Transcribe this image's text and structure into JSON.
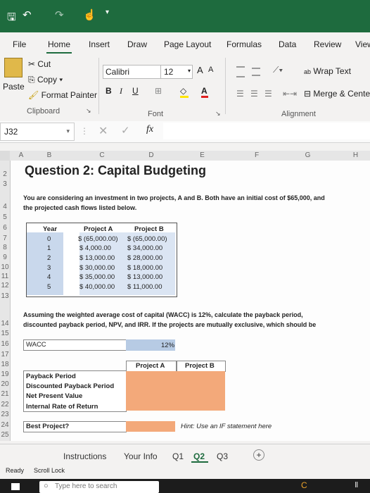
{
  "quick_access": {
    "undo": "↶",
    "redo": "↷"
  },
  "tabs": [
    "File",
    "Home",
    "Insert",
    "Draw",
    "Page Layout",
    "Formulas",
    "Data",
    "Review",
    "View"
  ],
  "clipboard": {
    "paste": "Paste",
    "cut": "Cut",
    "copy": "Copy",
    "format_painter": "Format Painter",
    "group": "Clipboard"
  },
  "font": {
    "name": "Calibri",
    "size": "12",
    "bold": "B",
    "italic": "I",
    "underline": "U",
    "group": "Font"
  },
  "alignment": {
    "wrap": "Wrap Text",
    "merge": "Merge & Center",
    "group": "Alignment"
  },
  "formula_bar": {
    "name_box": "J32",
    "fx": "fx",
    "value": ""
  },
  "columns": [
    "A",
    "B",
    "C",
    "D",
    "E",
    "F",
    "G",
    "H"
  ],
  "rows": [
    "2",
    "3",
    "4",
    "5",
    "6",
    "7",
    "8",
    "9",
    "10",
    "11",
    "12",
    "13",
    "14",
    "15",
    "16",
    "17",
    "18",
    "19",
    "20",
    "21",
    "22",
    "23",
    "24",
    "25"
  ],
  "sheet": {
    "title": "Question 2: Capital Budgeting",
    "intro_line1": "You are considering an investment in two projects, A and B. Both have an initial cost of $65,000, and",
    "intro_line2": "the projected cash flows listed below.",
    "table_headers": [
      "Year",
      "Project A",
      "Project B"
    ],
    "table_rows": [
      [
        "0",
        "$ (65,000.00)",
        "$ (65,000.00)"
      ],
      [
        "1",
        "$  4,000.00",
        "$  34,000.00"
      ],
      [
        "2",
        "$  13,000.00",
        "$  28,000.00"
      ],
      [
        "3",
        "$  30,000.00",
        "$  18,000.00"
      ],
      [
        "4",
        "$  35,000.00",
        "$  13,000.00"
      ],
      [
        "5",
        "$  40,000.00",
        "$  11,000.00"
      ]
    ],
    "q_line1": "Assuming the weighted average cost of capital (WACC) is 12%, calculate the payback period,",
    "q_line2": "discounted payback period, NPV, and IRR.  If the projects are mutually exclusive, which should be",
    "wacc_label": "WACC",
    "wacc_value": "12%",
    "col_a": "Project A",
    "col_b": "Project B",
    "metrics": [
      "Payback Period",
      "Discounted Payback Period",
      "Net Present Value",
      "Internal Rate of Return"
    ],
    "best_label": "Best Project?",
    "hint": "Hint: Use an IF statement here"
  },
  "sheet_tabs": [
    "Instructions",
    "Your Info",
    "Q1",
    "Q2",
    "Q3"
  ],
  "active_sheet_tab": "Q2",
  "status": {
    "ready": "Ready",
    "scroll": "Scroll Lock"
  },
  "taskbar": {
    "search": "Type here to search"
  }
}
